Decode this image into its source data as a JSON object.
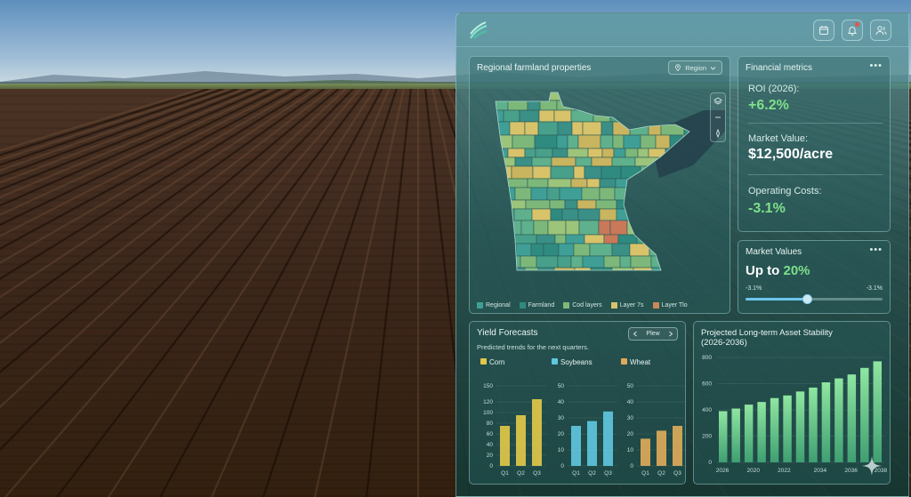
{
  "header": {
    "icons": [
      "calendar-icon",
      "bell-icon",
      "users-icon"
    ],
    "notification_color": "#e0554a"
  },
  "map_panel": {
    "title": "Regional farmland properties",
    "region_select": "Region",
    "tools": [
      "layers-icon",
      "zoom-out-icon",
      "compass-icon"
    ],
    "legend": [
      {
        "label": "Regional",
        "color": "#3f9f97"
      },
      {
        "label": "Farmland",
        "color": "#2f8a7f"
      },
      {
        "label": "Cod layers",
        "color": "#7db87a"
      },
      {
        "label": "Layer 7s",
        "color": "#d8c36a"
      },
      {
        "label": "Layer Tlo",
        "color": "#c98a5a"
      }
    ]
  },
  "financial": {
    "title": "Financial metrics",
    "roi_label": "ROI (2026):",
    "roi_value": "+6.2%",
    "market_label": "Market Value:",
    "market_value": "$12,500/acre",
    "costs_label": "Operating Costs:",
    "costs_value": "-3.1%",
    "positive_color": "#7ee08a"
  },
  "market_values": {
    "title": "Market Values",
    "prefix": "Up to",
    "highlight": "20%",
    "min_label": "-3.1%",
    "max_label": "-3.1%",
    "slider_level": 0.45,
    "accent": "#6cc6ee"
  },
  "yield": {
    "title": "Yield Forecasts",
    "subtitle": "Predicted trends for the next quarters.",
    "pill_label": "Plew"
  },
  "stability": {
    "title_line1": "Projected Long-term Asset Stability",
    "title_line2": "(2026-2036)"
  },
  "chart_data": [
    {
      "type": "bar",
      "title": "Corn",
      "categories": [
        "Q1",
        "Q2",
        "Q3"
      ],
      "values": [
        75,
        95,
        125
      ],
      "ylim": [
        0,
        150
      ],
      "yticks": [
        0,
        20,
        40,
        60,
        80,
        100,
        120,
        150
      ],
      "color": "#e0c84a"
    },
    {
      "type": "bar",
      "title": "Soybeans",
      "categories": [
        "Q1",
        "Q2",
        "Q3"
      ],
      "values": [
        25,
        28,
        34
      ],
      "ylim": [
        0,
        50
      ],
      "yticks": [
        0,
        10,
        20,
        30,
        40,
        50
      ],
      "color": "#5ec6de"
    },
    {
      "type": "bar",
      "title": "Wheat",
      "categories": [
        "Q1",
        "Q2",
        "Q3"
      ],
      "values": [
        17,
        22,
        25
      ],
      "ylim": [
        0,
        50
      ],
      "yticks": [
        0,
        10,
        20,
        30,
        40,
        50
      ],
      "color": "#dcaa5a"
    },
    {
      "type": "bar",
      "title": "Projected Long-term Asset Stability (2026-2036)",
      "x": [
        2026,
        2027,
        2028,
        2029,
        2030,
        2031,
        2032,
        2033,
        2034,
        2035,
        2036,
        2037,
        2038
      ],
      "values": [
        390,
        410,
        440,
        460,
        490,
        510,
        540,
        570,
        610,
        640,
        670,
        720,
        770
      ],
      "ylim": [
        0,
        800
      ],
      "yticks": [
        0,
        200,
        400,
        600,
        800
      ],
      "xticks": [
        "2026",
        "2020",
        "2022",
        "2034",
        "2036",
        "2038"
      ],
      "color": "#6fd38a"
    }
  ]
}
